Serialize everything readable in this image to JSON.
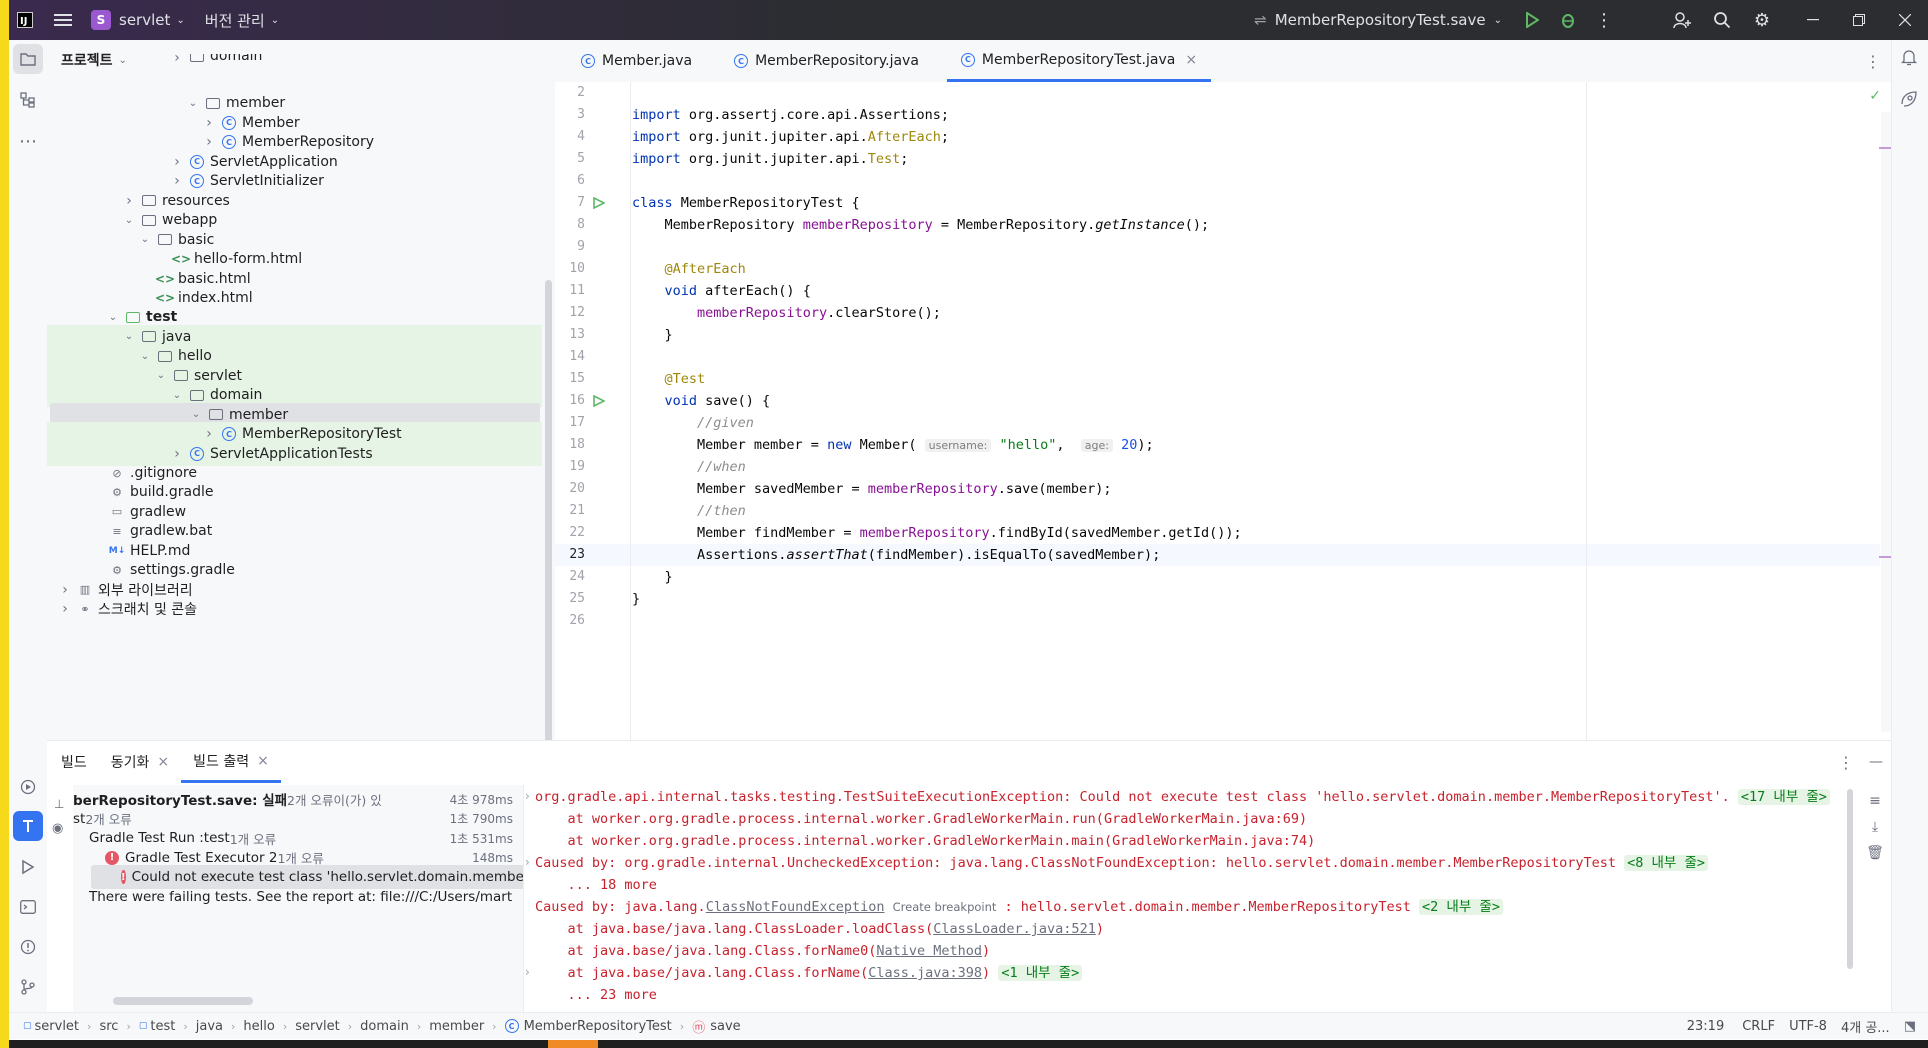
{
  "titlebar": {
    "project_badge": "S",
    "project_name": "servlet",
    "vcs_label": "버전 관리",
    "run_config": "MemberRepositoryTest.save"
  },
  "project_panel": {
    "title": "프로젝트",
    "items": [
      {
        "label": "domain",
        "type": "folder",
        "indent": 7
      },
      {
        "label": "member",
        "type": "folder",
        "indent": 8,
        "open": true
      },
      {
        "label": "Member",
        "type": "class",
        "indent": 9
      },
      {
        "label": "MemberRepository",
        "type": "class",
        "indent": 9
      },
      {
        "label": "ServletApplication",
        "type": "class",
        "indent": 7
      },
      {
        "label": "ServletInitializer",
        "type": "class",
        "indent": 7
      },
      {
        "label": "resources",
        "type": "folder",
        "indent": 4
      },
      {
        "label": "webapp",
        "type": "folder",
        "indent": 4,
        "open": true
      },
      {
        "label": "basic",
        "type": "folder",
        "indent": 5,
        "open": true
      },
      {
        "label": "hello-form.html",
        "type": "html",
        "indent": 6
      },
      {
        "label": "basic.html",
        "type": "html",
        "indent": 5
      },
      {
        "label": "index.html",
        "type": "html",
        "indent": 5
      },
      {
        "label": "test",
        "type": "folder",
        "indent": 3,
        "open": true,
        "bold": true
      },
      {
        "label": "java",
        "type": "folder",
        "indent": 4,
        "open": true,
        "green": true
      },
      {
        "label": "hello",
        "type": "folder",
        "indent": 5,
        "open": true,
        "green": true
      },
      {
        "label": "servlet",
        "type": "folder",
        "indent": 6,
        "open": true,
        "green": true
      },
      {
        "label": "domain",
        "type": "folder",
        "indent": 7,
        "open": true,
        "green": true
      },
      {
        "label": "member",
        "type": "folder",
        "indent": 8,
        "open": true,
        "green": true,
        "selected": true
      },
      {
        "label": "MemberRepositoryTest",
        "type": "class",
        "indent": 9,
        "green": true
      },
      {
        "label": "ServletApplicationTests",
        "type": "class",
        "indent": 7,
        "green": true
      },
      {
        "label": ".gitignore",
        "type": "file",
        "indent": 2,
        "icon": "⊘"
      },
      {
        "label": "build.gradle",
        "type": "file",
        "indent": 2,
        "icon": "⚙"
      },
      {
        "label": "gradlew",
        "type": "file",
        "indent": 2,
        "icon": "▭"
      },
      {
        "label": "gradlew.bat",
        "type": "file",
        "indent": 2,
        "icon": "≡"
      },
      {
        "label": "HELP.md",
        "type": "file",
        "indent": 2,
        "icon": "M↓"
      },
      {
        "label": "settings.gradle",
        "type": "file",
        "indent": 2,
        "icon": "⚙"
      },
      {
        "label": "외부 라이브러리",
        "type": "lib",
        "indent": 0
      },
      {
        "label": "스크래치 및 콘솔",
        "type": "scratch",
        "indent": 0
      }
    ]
  },
  "editor": {
    "tabs": [
      {
        "label": "Member.java",
        "active": false
      },
      {
        "label": "MemberRepository.java",
        "active": false
      },
      {
        "label": "MemberRepositoryTest.java",
        "active": true
      }
    ],
    "current_line": 23,
    "lines": [
      {
        "n": "2",
        "html": ""
      },
      {
        "n": "3",
        "html": "<span class='kw'>import</span> org.assertj.core.api.Assertions;"
      },
      {
        "n": "4",
        "html": "<span class='kw'>import</span> org.junit.jupiter.api.<span class='ann'>AfterEach</span>;"
      },
      {
        "n": "5",
        "html": "<span class='kw'>import</span> org.junit.jupiter.api.<span class='ann'>Test</span>;"
      },
      {
        "n": "6",
        "html": ""
      },
      {
        "n": "7",
        "html": "<span class='kw'>class</span> MemberRepositoryTest {",
        "run": true
      },
      {
        "n": "8",
        "html": "    MemberRepository <span class='fld'>memberRepository</span> = MemberRepository.<span class='it'>getInstance</span>();"
      },
      {
        "n": "9",
        "html": ""
      },
      {
        "n": "10",
        "html": "    <span class='ann'>@AfterEach</span>"
      },
      {
        "n": "11",
        "html": "    <span class='kw'>void</span> afterEach() {"
      },
      {
        "n": "12",
        "html": "        <span class='fld'>memberRepository</span>.clearStore();"
      },
      {
        "n": "13",
        "html": "    }"
      },
      {
        "n": "14",
        "html": ""
      },
      {
        "n": "15",
        "html": "    <span class='ann'>@Test</span>"
      },
      {
        "n": "16",
        "html": "    <span class='kw'>void</span> save() {",
        "run": true
      },
      {
        "n": "17",
        "html": "        <span class='cm'>//given</span>"
      },
      {
        "n": "18",
        "html": "        Member member = <span class='kw'>new</span> Member( <span class='hint'>username:</span> <span class='str'>\"hello\"</span>,  <span class='hint'>age:</span> <span class='num'>20</span>);"
      },
      {
        "n": "19",
        "html": "        <span class='cm'>//when</span>"
      },
      {
        "n": "20",
        "html": "        Member savedMember = <span class='fld'>memberRepository</span>.save(member);"
      },
      {
        "n": "21",
        "html": "        <span class='cm'>//then</span>"
      },
      {
        "n": "22",
        "html": "        Member findMember = <span class='fld'>memberRepository</span>.findById(savedMember.getId());"
      },
      {
        "n": "23",
        "html": "        Assertions.<span class='it'>assertThat</span>(findMember).isEqualTo(savedMember);"
      },
      {
        "n": "24",
        "html": "    }"
      },
      {
        "n": "25",
        "html": "}"
      },
      {
        "n": "26",
        "html": ""
      }
    ]
  },
  "bottom_panel": {
    "tabs": [
      {
        "label": "빌드",
        "active": false,
        "closable": false
      },
      {
        "label": "동기화",
        "active": false,
        "closable": true
      },
      {
        "label": "빌드 출력",
        "active": true,
        "closable": true
      }
    ],
    "tree": [
      {
        "label": "berRepositoryTest.save: 실패",
        "extra": " 2개 오류이(가) 있",
        "dur": "4초 978ms",
        "indent": 0,
        "bold": true
      },
      {
        "label": "st",
        "extra": " 2개 오류",
        "dur": "1초 790ms",
        "indent": 0
      },
      {
        "label": "Gradle Test Run :test",
        "extra": " 1개 오류",
        "dur": "1초 531ms",
        "indent": 1
      },
      {
        "label": "Gradle Test Executor 2",
        "extra": " 1개 오류",
        "dur": "148ms",
        "indent": 2,
        "error": true
      },
      {
        "label": "Could not execute test class 'hello.servlet.domain.membe",
        "extra": "",
        "dur": "",
        "indent": 3,
        "error": true,
        "selected": true
      },
      {
        "label": "There were failing tests. See the report at: file:///C:/Users/mart",
        "extra": "",
        "dur": "",
        "indent": 1
      }
    ],
    "console": [
      {
        "html": "org.gradle.api.internal.tasks.testing.TestSuiteExecutionException: Could not execute test class 'hello.servlet.domain.member.MemberRepositoryTest'. <span class='fold'>&lt;17 내부 줄&gt;</span>",
        "fold": true
      },
      {
        "html": "    at worker.org.gradle.process.internal.worker.GradleWorkerMain.run(GradleWorkerMain.java:69)"
      },
      {
        "html": "    at worker.org.gradle.process.internal.worker.GradleWorkerMain.main(GradleWorkerMain.java:74)"
      },
      {
        "html": "Caused by: org.gradle.internal.UncheckedException: java.lang.ClassNotFoundException: hello.servlet.domain.member.MemberRepositoryTest <span class='fold'>&lt;8 내부 줄&gt;</span>",
        "fold": true
      },
      {
        "html": "    ... 18 more"
      },
      {
        "html": "Caused by: java.lang.<span class='link'>ClassNotFoundException</span> <span class='bp'>Create breakpoint</span> : hello.servlet.domain.member.MemberRepositoryTest <span class='fold'>&lt;2 내부 줄&gt;</span>"
      },
      {
        "html": "    at java.base/java.lang.ClassLoader.loadClass(<span class='link'>ClassLoader.java:521</span>)"
      },
      {
        "html": "    at java.base/java.lang.Class.forName0(<span class='link'>Native Method</span>)"
      },
      {
        "html": "    at java.base/java.lang.Class.forName(<span class='link'>Class.java:398</span>) <span class='fold'>&lt;1 내부 줄&gt;</span>",
        "fold": true
      },
      {
        "html": "    ... 23 more"
      }
    ]
  },
  "statusbar": {
    "breadcrumbs": [
      "servlet",
      "src",
      "test",
      "java",
      "hello",
      "servlet",
      "domain",
      "member",
      "MemberRepositoryTest",
      "save"
    ],
    "position": "23:19",
    "line_sep": "CRLF",
    "encoding": "UTF-8",
    "indent": "4개 공..."
  }
}
